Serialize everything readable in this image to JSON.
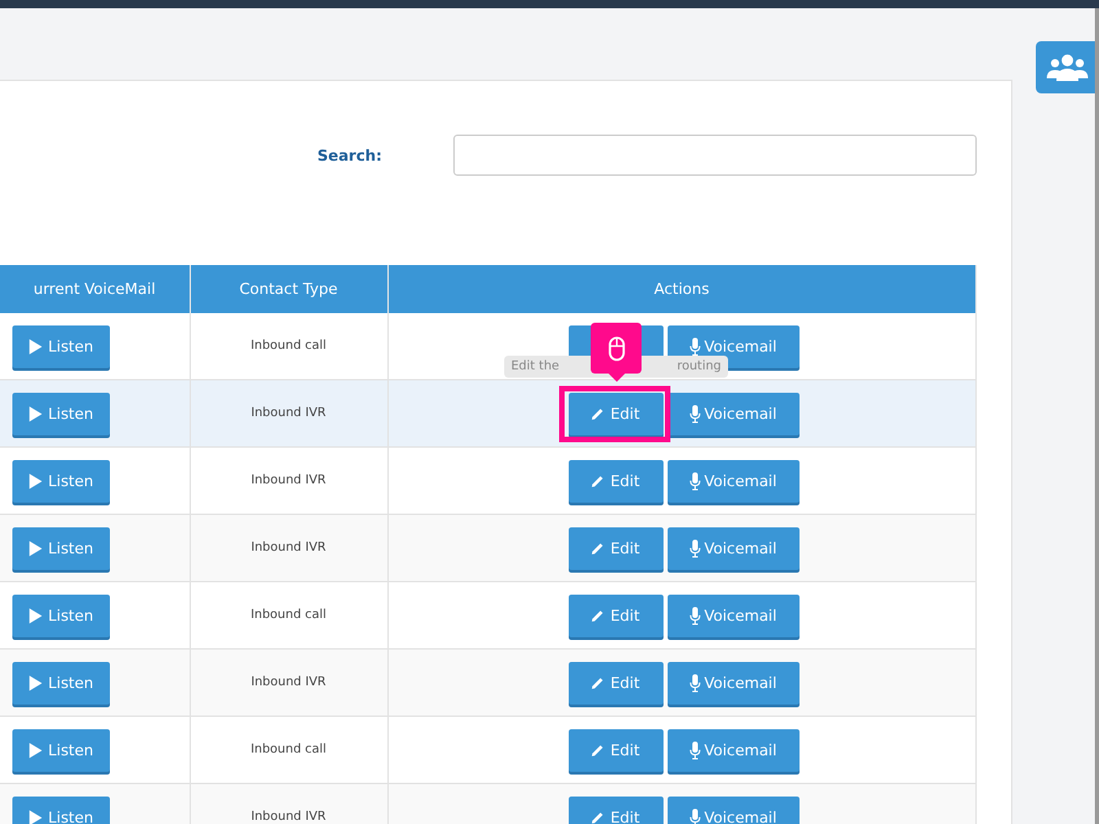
{
  "search": {
    "label": "Search:"
  },
  "table": {
    "columns": [
      "urrent VoiceMail",
      "Contact Type",
      "Actions"
    ],
    "rows": [
      {
        "listen": "Listen",
        "contact_type": "Inbound call",
        "voicemail": "Voicemail",
        "selected": false
      },
      {
        "listen": "Listen",
        "contact_type": "Inbound IVR",
        "edit": "Edit",
        "voicemail": "Voicemail",
        "selected": true
      },
      {
        "listen": "Listen",
        "contact_type": "Inbound IVR",
        "edit": "Edit",
        "voicemail": "Voicemail",
        "selected": false
      },
      {
        "listen": "Listen",
        "contact_type": "Inbound IVR",
        "edit": "Edit",
        "voicemail": "Voicemail",
        "selected": false
      },
      {
        "listen": "Listen",
        "contact_type": "Inbound call",
        "edit": "Edit",
        "voicemail": "Voicemail",
        "selected": false
      },
      {
        "listen": "Listen",
        "contact_type": "Inbound IVR",
        "edit": "Edit",
        "voicemail": "Voicemail",
        "selected": false
      },
      {
        "listen": "Listen",
        "contact_type": "Inbound call",
        "edit": "Edit",
        "voicemail": "Voicemail",
        "selected": false
      },
      {
        "listen": "Listen",
        "contact_type": "Inbound IVR",
        "edit": "Edit",
        "voicemail": "Voicemail",
        "selected": false
      }
    ]
  },
  "tooltip": {
    "text_start": "Edit the",
    "text_end": "routing"
  }
}
